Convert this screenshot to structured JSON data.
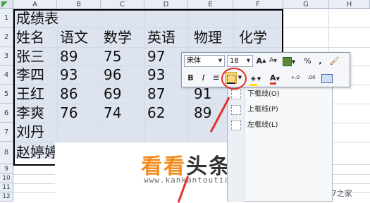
{
  "columns": [
    "A",
    "B",
    "C",
    "D",
    "E",
    "F",
    "G",
    "H"
  ],
  "rows": [
    "1",
    "2",
    "3",
    "4",
    "5",
    "6",
    "7",
    "8",
    "9",
    "10",
    "11",
    "12"
  ],
  "sheet": {
    "title": "成绩表",
    "headers": [
      "姓名",
      "语文",
      "数学",
      "英语",
      "物理",
      "化学"
    ],
    "data": [
      [
        "张三",
        "89",
        "75",
        "97",
        "",
        ""
      ],
      [
        "李四",
        "93",
        "96",
        "93",
        "",
        ""
      ],
      [
        "王红",
        "86",
        "69",
        "87",
        "91",
        ""
      ],
      [
        "李爽",
        "76",
        "74",
        "62",
        "89",
        ""
      ],
      [
        "刘丹",
        "",
        "",
        "",
        "",
        ""
      ],
      [
        "赵婷婷",
        "",
        "",
        "",
        "",
        ""
      ]
    ]
  },
  "mini_toolbar": {
    "font_name": "宋体",
    "font_size": "18",
    "grow_font": "A",
    "shrink_font": "A",
    "percent": "%",
    "comma": ",",
    "bold": "B",
    "italic": "I",
    "font_color_label": "A",
    "inc_decimal": "+.0",
    "dec_decimal": ".00"
  },
  "border_menu": {
    "items": [
      "下框线(O)",
      "上框线(P)",
      "左框线(L)"
    ]
  },
  "watermark": {
    "brand_orange": "看看",
    "brand_dark": "头条",
    "url": "www.kankantoutiao.com",
    "corner_text": "Win7之家"
  },
  "colors": {
    "selection_fill": "#dde4ef",
    "header_fill": "#e9eef6",
    "highlight_circle": "#e0322b",
    "brand_orange": "#f28a1c"
  }
}
